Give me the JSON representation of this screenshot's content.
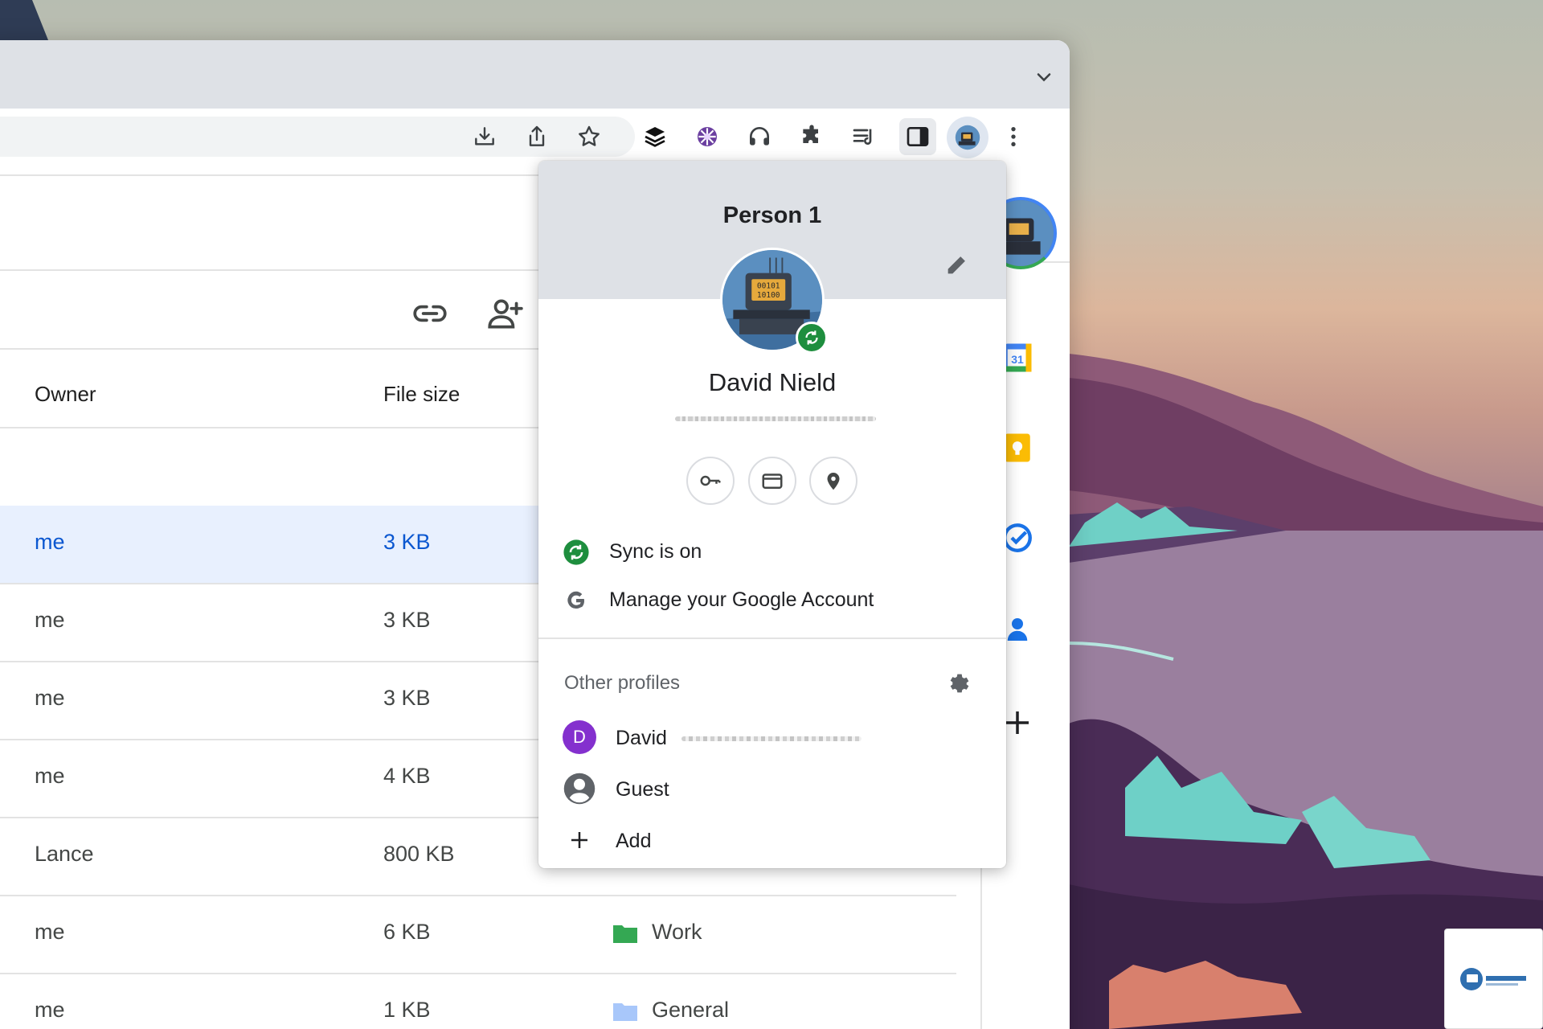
{
  "toolbar": {
    "icons": [
      "download-icon",
      "share-icon",
      "bookmark-star-icon",
      "buffer-extension-icon",
      "flower-extension-icon",
      "headphones-extension-icon",
      "extensions-puzzle-icon",
      "reading-list-icon",
      "side-panel-icon",
      "profile-avatar-button",
      "more-menu-icon"
    ]
  },
  "table": {
    "columns": [
      "Owner",
      "File size"
    ],
    "rows": [
      {
        "owner": "me",
        "size": "3 KB",
        "location": "",
        "selected": true
      },
      {
        "owner": "me",
        "size": "3 KB",
        "location": ""
      },
      {
        "owner": "me",
        "size": "3 KB",
        "location": ""
      },
      {
        "owner": "me",
        "size": "4 KB",
        "location": ""
      },
      {
        "owner": "Lance",
        "size": "800 KB",
        "location": ""
      },
      {
        "owner": "me",
        "size": "6 KB",
        "location": "Work"
      },
      {
        "owner": "me",
        "size": "1 KB",
        "location": "General"
      }
    ]
  },
  "profile_menu": {
    "title": "Person 1",
    "user_name": "David Nield",
    "quick_actions": [
      "passwords-key-icon",
      "payment-card-icon",
      "address-pin-icon"
    ],
    "sync_label": "Sync is on",
    "manage_label": "Manage your Google Account",
    "other_profiles_label": "Other profiles",
    "profiles": [
      {
        "initial": "D",
        "name": "David"
      },
      {
        "name": "Guest"
      },
      {
        "name": "Add"
      }
    ]
  },
  "right_rail": [
    "google-calendar-icon",
    "google-keep-icon",
    "google-tasks-icon",
    "google-contacts-icon",
    "add-icon"
  ],
  "calendar_day": "31",
  "colors": {
    "accent_blue": "#0b57d0",
    "selected_row_bg": "#e8f0fe",
    "sync_green": "#1e8e3e",
    "profile_purple": "#8430ce",
    "header_gray": "#dee1e6"
  }
}
